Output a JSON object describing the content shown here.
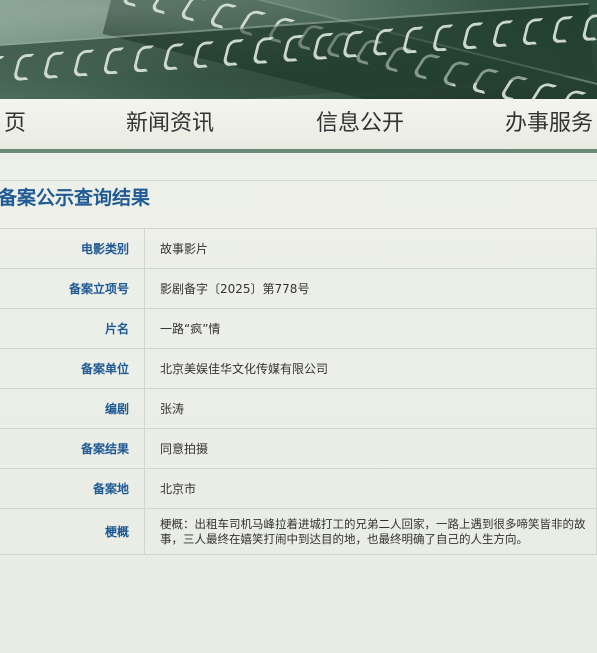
{
  "nav": {
    "items": [
      {
        "label": "页"
      },
      {
        "label": "新闻资讯"
      },
      {
        "label": "信息公开"
      },
      {
        "label": "办事服务"
      }
    ]
  },
  "page_title": "备案公示查询结果",
  "record": {
    "rows": [
      {
        "label": "电影类别",
        "value": "故事影片"
      },
      {
        "label": "备案立项号",
        "value": "影剧备字〔2025〕第778号"
      },
      {
        "label": "片名",
        "value": "一路“疯”情"
      },
      {
        "label": "备案单位",
        "value": "北京美娱佳华文化传媒有限公司"
      },
      {
        "label": "编剧",
        "value": "张涛"
      },
      {
        "label": "备案结果",
        "value": "同意拍摄"
      },
      {
        "label": "备案地",
        "value": "北京市"
      },
      {
        "label": "梗概",
        "value": "梗概：出租车司机马峰拉着进城打工的兄弟二人回家，一路上遇到很多啼笑皆非的故事，三人最终在嬉笑打闹中到达目的地，也最终明确了自己的人生方向。"
      }
    ]
  },
  "colors": {
    "banner_green": "#3f5f4c",
    "nav_border": "#6d8a77",
    "title_blue": "#1f5a94",
    "label_blue": "#1f5a94",
    "background": "#eef0ea"
  }
}
